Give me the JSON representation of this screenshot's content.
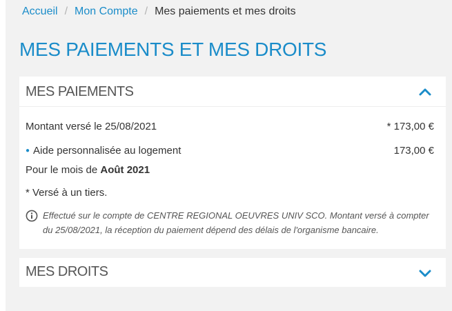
{
  "breadcrumb": {
    "items": [
      {
        "label": "Accueil"
      },
      {
        "label": "Mon Compte"
      }
    ],
    "separator": "/",
    "current": "Mes paiements et mes droits"
  },
  "page_title": "MES PAIEMENTS ET MES DROITS",
  "payments_section": {
    "title": "MES PAIEMENTS",
    "expanded": true,
    "toggle_icon": "chevron-up-icon",
    "amount_label": "Montant versé le 25/08/2021",
    "amount_value": "* 173,00 €",
    "aide_label": "Aide personnalisée au logement",
    "aide_value": "173,00 €",
    "month_prefix": "Pour le mois de ",
    "month_value": "Août 2021",
    "tiers_note": "* Versé à un tiers.",
    "info_icon": "info-circle-icon",
    "info_text": "Effectué sur le compte de CENTRE REGIONAL OEUVRES UNIV SCO. Montant versé à compter du 25/08/2021, la réception du paiement dépend des délais de l'organisme bancaire."
  },
  "rights_section": {
    "title": "MES DROITS",
    "expanded": false,
    "toggle_icon": "chevron-down-icon"
  },
  "colors": {
    "accent": "#1a8cc9",
    "panel_background": "#f2f2f2",
    "card_background": "#ffffff",
    "text": "#333333"
  }
}
